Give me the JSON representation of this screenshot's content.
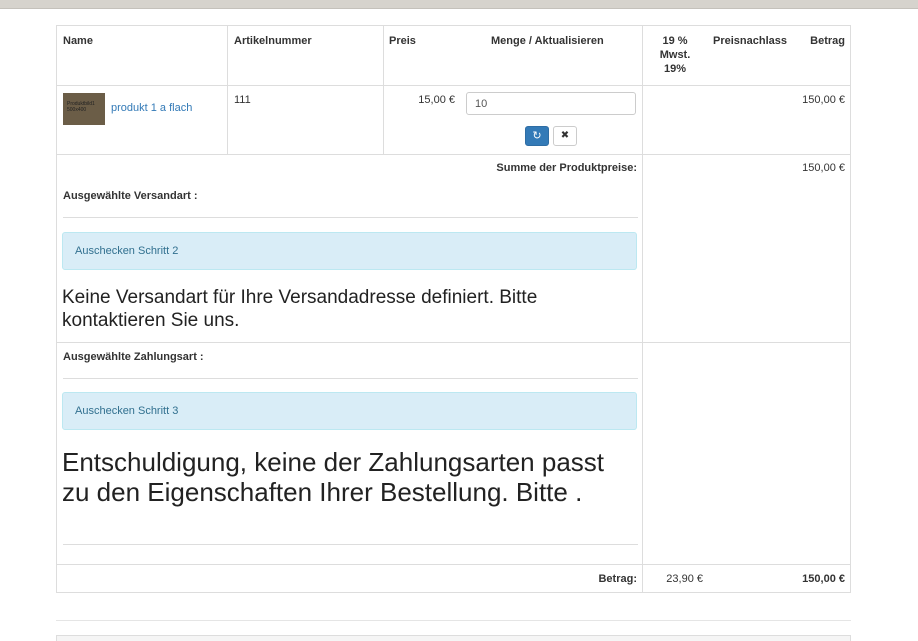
{
  "table": {
    "headers": {
      "name": "Name",
      "article_number": "Artikelnummer",
      "price": "Preis",
      "quantity_update": "Menge / Aktualisieren",
      "vat_line1": "19 %",
      "vat_line2": "Mwst.",
      "vat_line3": "19%",
      "discount": "Preisnachlass",
      "amount": "Betrag"
    },
    "product": {
      "thumbnail_text_line1": "Produktbild1",
      "thumbnail_text_line2": "500x400",
      "name": "produkt 1 a flach",
      "article_number": "111",
      "price": "15,00 €",
      "quantity": "10",
      "amount": "150,00 €"
    },
    "subtotal_label": "Summe der Produktpreise:",
    "subtotal_value": "150,00 €",
    "shipping": {
      "label": "Ausgewählte Versandart :",
      "step_alert": "Auschecken Schritt 2",
      "message": "Keine Versandart für Ihre Versandadresse definiert. Bitte kontaktieren Sie uns."
    },
    "payment": {
      "label": "Ausgewählte Zahlungsart :",
      "step_alert": "Auschecken Schritt 3",
      "message": "Entschuldigung, keine der Zahlungsarten passt zu den Eigenschaften Ihrer Bestellung. Bitte ."
    },
    "total": {
      "label": "Betrag:",
      "vat": "23,90 €",
      "amount": "150,00 €"
    }
  },
  "buttons": {
    "refresh_icon": "refresh-icon",
    "remove_icon": "close-icon"
  },
  "colors": {
    "link": "#337ab7",
    "primary_button": "#337ab7",
    "alert_bg": "#d9edf7",
    "alert_text": "#31708f",
    "border": "#dddddd"
  }
}
